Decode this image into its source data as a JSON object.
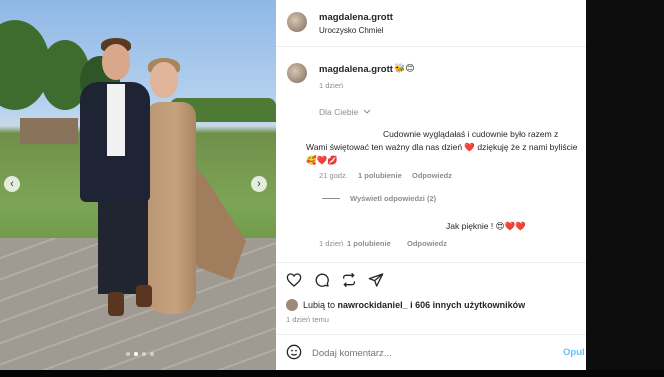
{
  "post": {
    "username": "magdalena.grott",
    "location": "Uroczysko Chmiel",
    "caption_emojis": "🐝😊",
    "caption_time": "1 dzień"
  },
  "filter": {
    "label": "Dla Ciebie"
  },
  "comments": [
    {
      "text": "Cudownie wyglądałaś i cudownie było razem z Wami świętować ten ważny dla nas dzień ❤️ dziękuję że z nami byliście 🥰❤️💋",
      "time": "21 godz.",
      "likes": "1 polubienie",
      "reply": "Odpowiedz",
      "view_replies": "Wyświetl odpowiedzi (2)"
    },
    {
      "text": "Jak pięknie ! 😍❤️❤️",
      "time": "1 dzień",
      "likes": "1 polubienie",
      "reply": "Odpowiedz"
    }
  ],
  "likes_line": {
    "prefix": "Lubią to",
    "user": "nawrockidaniel_",
    "rest": "i 606 innych użytkowników"
  },
  "post_time": "1 dzień temu",
  "comment_input": {
    "placeholder": "Dodaj komentarz...",
    "submit": "Opul"
  },
  "carousel": {
    "prev": "‹",
    "next": "›"
  },
  "colors": {
    "like_red": "#ed4956",
    "link_blue": "#0095f6"
  }
}
